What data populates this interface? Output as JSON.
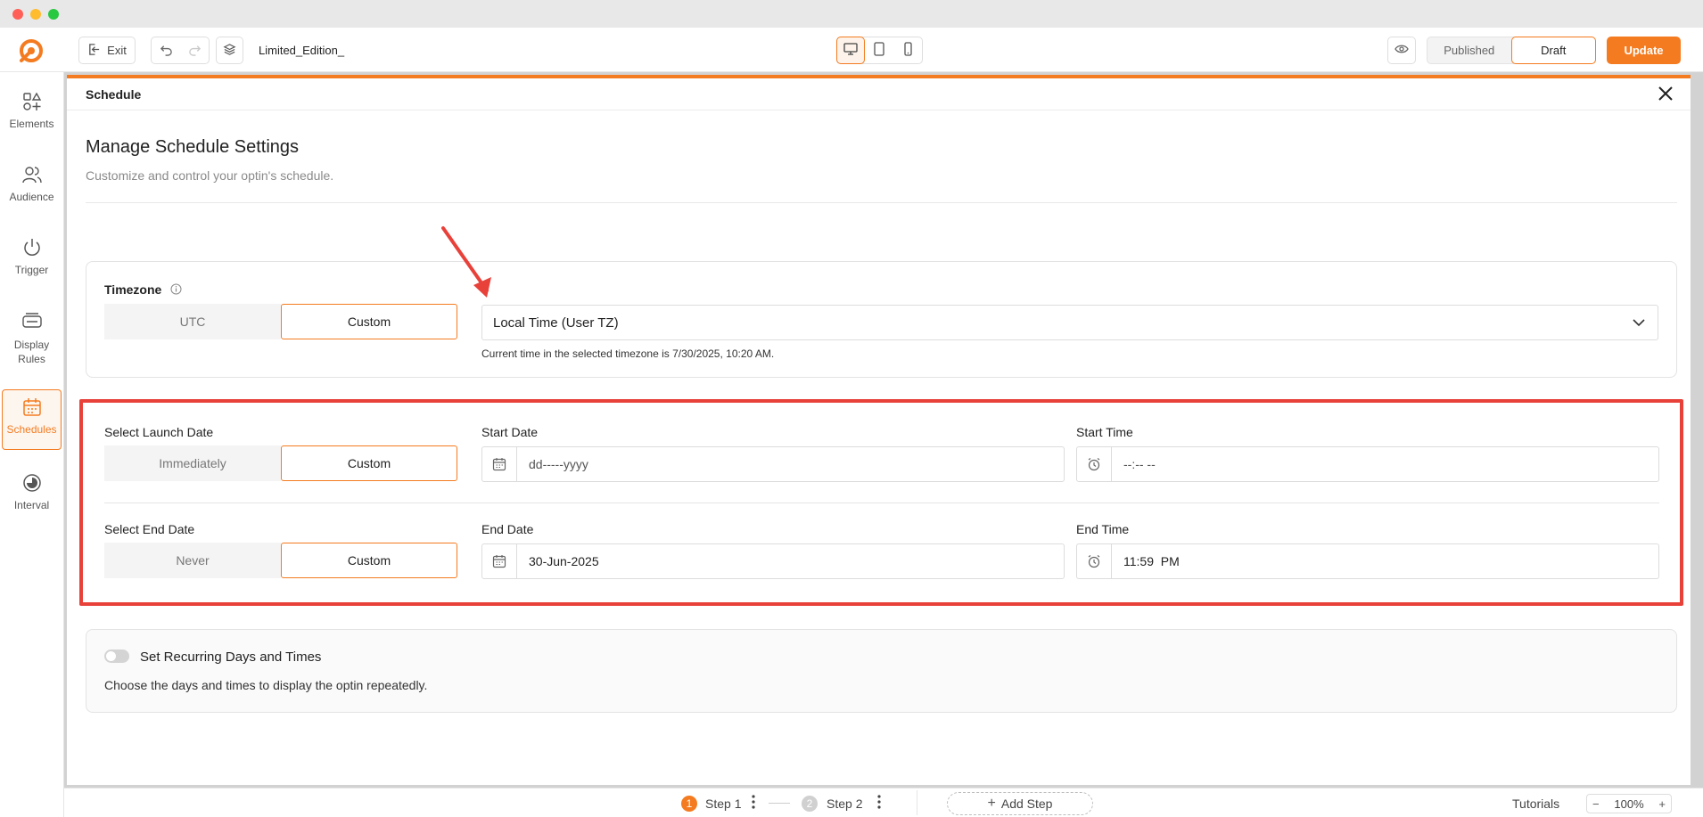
{
  "window": {
    "traffic_colors": [
      "#ff5f57",
      "#febc2e",
      "#28c840"
    ]
  },
  "topbar": {
    "exit_label": "Exit",
    "campaign_name": "Limited_Edition_",
    "published_label": "Published",
    "draft_label": "Draft",
    "update_label": "Update",
    "accent": "#f47b20"
  },
  "sidebar": {
    "items": [
      {
        "label": "Elements",
        "icon": "elements-icon"
      },
      {
        "label": "Audience",
        "icon": "audience-icon"
      },
      {
        "label": "Trigger",
        "icon": "power-icon"
      },
      {
        "label": "Display Rules",
        "icon": "display-rules-icon"
      },
      {
        "label": "Schedules",
        "icon": "calendar-icon",
        "active": true
      },
      {
        "label": "Interval",
        "icon": "interval-icon"
      }
    ]
  },
  "panel": {
    "header_title": "Schedule",
    "title": "Manage Schedule Settings",
    "subtitle": "Customize and control your optin's schedule."
  },
  "timezone": {
    "label": "Timezone",
    "option_utc": "UTC",
    "option_custom": "Custom",
    "selected_value": "Local Time (User TZ)",
    "current_time_note": "Current time in the selected timezone is 7/30/2025, 10:20 AM."
  },
  "launch": {
    "label": "Select Launch Date",
    "option_immediately": "Immediately",
    "option_custom": "Custom",
    "start_date_label": "Start Date",
    "start_date_value": "dd-----yyyy",
    "start_time_label": "Start Time",
    "start_time_value": "--:-- --"
  },
  "end": {
    "label": "Select End Date",
    "option_never": "Never",
    "option_custom": "Custom",
    "end_date_label": "End Date",
    "end_date_value": "30-Jun-2025",
    "end_time_label": "End Time",
    "end_time_value": "11:59  PM"
  },
  "recurring": {
    "label": "Set Recurring Days and Times",
    "description": "Choose the days and times to display the optin repeatedly.",
    "enabled": false
  },
  "bottombar": {
    "step1_num": "1",
    "step1_label": "Step 1",
    "step2_num": "2",
    "step2_label": "Step 2",
    "add_step_label": "Add Step",
    "tutorials_label": "Tutorials",
    "zoom_value": "100%"
  },
  "annotation": {
    "highlight_color": "#e8413a"
  }
}
